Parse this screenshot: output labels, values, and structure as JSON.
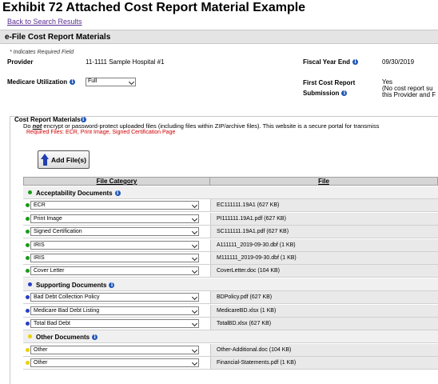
{
  "exhibit_title": "Exhibit 72 Attached Cost Report Material Example",
  "back_link": "Back to Search Results",
  "panel_title": "e-File Cost Report Materials",
  "required_note": "* Indicates Required Field",
  "provider": {
    "label": "Provider",
    "value": "11-1111 Sample Hospital #1"
  },
  "fiscal_year_end": {
    "label": "Fiscal Year End",
    "value": "09/30/2019"
  },
  "medicare_utilization": {
    "label": "Medicare Utilization",
    "value": "Full"
  },
  "first_cost_report": {
    "label_line1": "First Cost Report",
    "label_line2": "Submission",
    "value_line1": "Yes",
    "value_line2": "(No cost report su",
    "value_line3": "this Provider and F"
  },
  "materials": {
    "label": "Cost Report Materials",
    "warning_pre": "Do ",
    "warning_not": "not",
    "warning_post": " encrypt or password-protect uploaded files (including files within ZIP/archive files). This website is a secure portal for transmiss",
    "required_files": "Required Files: ECR, Print Image, Signed Certification Page",
    "add_button": "Add File(s)"
  },
  "table": {
    "col_category": "File Category",
    "col_file": "File",
    "groups": [
      {
        "title": "Acceptability Documents",
        "dot_color": "#1a9a1a",
        "rows": [
          {
            "category": "ECR",
            "file": "EC111111.19A1 (627 KB)"
          },
          {
            "category": "Print Image",
            "file": "PI111111.19A1.pdf (627 KB)"
          },
          {
            "category": "Signed Certification",
            "file": "SC111111.19A1.pdf (627 KB)"
          },
          {
            "category": "IRIS",
            "file": "A111111_2019-09-30.dbf (1 KB)"
          },
          {
            "category": "IRIS",
            "file": "M111111_2019-09-30.dbf (1 KB)"
          },
          {
            "category": "Cover Letter",
            "file": "CoverLetter.doc (104 KB)"
          }
        ]
      },
      {
        "title": "Supporting Documents",
        "dot_color": "#2a3ec8",
        "rows": [
          {
            "category": "Bad Debt Collection Policy",
            "file": "BDPolicy.pdf (627 KB)"
          },
          {
            "category": "Medicare Bad Debt Listing",
            "file": "MedicareBD.xlsx (1 KB)"
          },
          {
            "category": "Total Bad Debt",
            "file": "TotalBD.xlsx (627 KB)"
          }
        ]
      },
      {
        "title": "Other Documents",
        "dot_color": "#e8d200",
        "rows": [
          {
            "category": "Other",
            "file": "Other-Additional.doc (104 KB)"
          },
          {
            "category": "Other",
            "file": "Financial-Statements.pdf (1 KB)"
          }
        ]
      }
    ]
  }
}
